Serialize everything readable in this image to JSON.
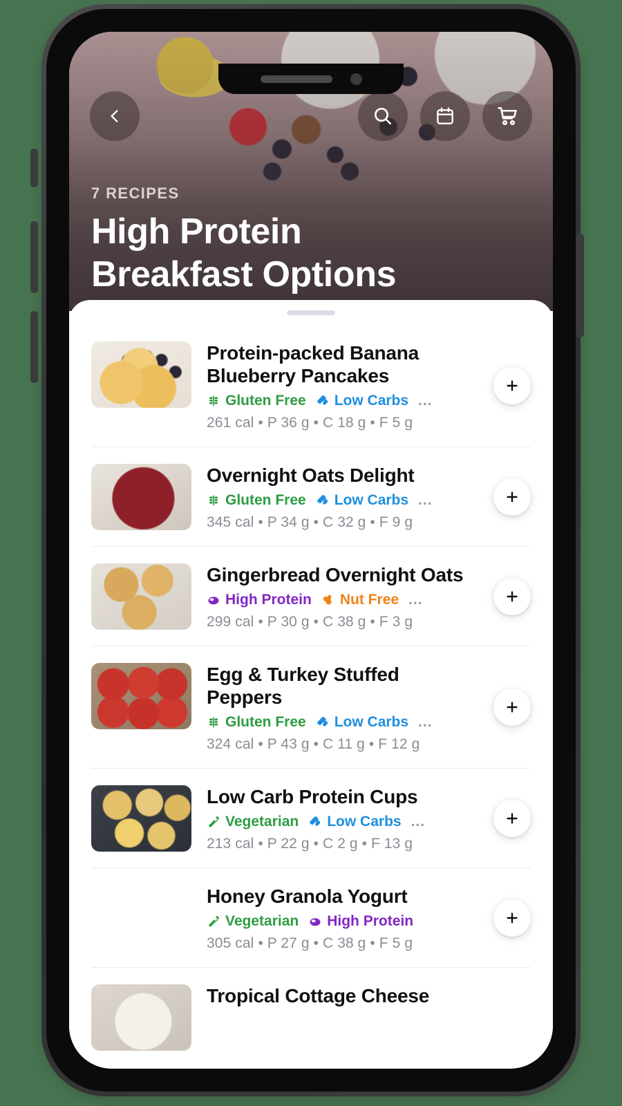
{
  "theme": {
    "page_background": "#477450",
    "sheet_background": "#ffffff",
    "title_color": "#ffffff",
    "tag_colors": {
      "gluten_free": "#2e9c41",
      "low_carbs": "#1e8fe0",
      "high_protein": "#8126c4",
      "nut_free": "#f08317",
      "vegetarian": "#2e9c41"
    },
    "macro_text_color": "#8b8b95",
    "recipe_title_color": "#111111"
  },
  "hero": {
    "back_icon": "chevron-left-icon",
    "actions": [
      {
        "icon": "search-icon",
        "name": "search-button"
      },
      {
        "icon": "calendar-icon",
        "name": "calendar-button"
      },
      {
        "icon": "shopping-cart-icon",
        "name": "cart-button"
      }
    ],
    "eyebrow": "7 RECIPES",
    "title_line1": "High Protein",
    "title_line2": "Breakfast Options"
  },
  "sheet": {
    "grabber": "drag-handle",
    "add_button_icon": "plus-icon",
    "tag_overflow": "...",
    "recipes": [
      {
        "title_line1": "Protein-packed Banana",
        "title_line2": "Blueberry Pancakes",
        "thumb": "pancakes-with-blueberries",
        "tags": [
          {
            "label": "Gluten Free",
            "icon": "wheat-icon",
            "color": "#2e9c41"
          },
          {
            "label": "Low Carbs",
            "icon": "bread-slice-icon",
            "color": "#1e8fe0"
          }
        ],
        "has_more_tags": true,
        "macros": "261 cal • P 36 g • C 18 g • F 5 g"
      },
      {
        "title_line1": "Overnight Oats Delight",
        "title_line2": "",
        "thumb": "berry-oats-bowl",
        "tags": [
          {
            "label": "Gluten Free",
            "icon": "wheat-icon",
            "color": "#2e9c41"
          },
          {
            "label": "Low Carbs",
            "icon": "bread-slice-icon",
            "color": "#1e8fe0"
          }
        ],
        "has_more_tags": true,
        "macros": "345 cal • P 34 g • C 32 g • F 9 g"
      },
      {
        "title_line1": "Gingerbread Overnight Oats",
        "title_line2": "",
        "thumb": "gingerbread-oat-jars",
        "tags": [
          {
            "label": "High Protein",
            "icon": "meat-icon",
            "color": "#8126c4"
          },
          {
            "label": "Nut Free",
            "icon": "peanut-icon",
            "color": "#f08317"
          }
        ],
        "has_more_tags": true,
        "macros": "299 cal • P 30 g • C 38 g • F 3 g"
      },
      {
        "title_line1": "Egg & Turkey Stuffed Peppers",
        "title_line2": "",
        "thumb": "stuffed-red-peppers",
        "tags": [
          {
            "label": "Gluten Free",
            "icon": "wheat-icon",
            "color": "#2e9c41"
          },
          {
            "label": "Low Carbs",
            "icon": "bread-slice-icon",
            "color": "#1e8fe0"
          }
        ],
        "has_more_tags": true,
        "macros": "324 cal • P 43 g • C 11 g • F 12 g"
      },
      {
        "title_line1": "Low Carb Protein Cups",
        "title_line2": "",
        "thumb": "egg-muffin-tin",
        "tags": [
          {
            "label": "Vegetarian",
            "icon": "carrot-icon",
            "color": "#2e9c41"
          },
          {
            "label": "Low Carbs",
            "icon": "bread-slice-icon",
            "color": "#1e8fe0"
          }
        ],
        "has_more_tags": true,
        "macros": "213 cal • P 22 g • C 2 g • F 13 g"
      },
      {
        "title_line1": "Honey Granola Yogurt",
        "title_line2": "",
        "thumb": "yogurt-parfait-glass",
        "tags": [
          {
            "label": "Vegetarian",
            "icon": "carrot-icon",
            "color": "#2e9c41"
          },
          {
            "label": "High Protein",
            "icon": "meat-icon",
            "color": "#8126c4"
          }
        ],
        "has_more_tags": false,
        "macros": "305 cal • P 27 g • C 38 g • F 5 g"
      },
      {
        "title_line1": "Tropical Cottage Cheese",
        "title_line2": "",
        "thumb": "cottage-cheese-bowl",
        "tags": [],
        "has_more_tags": false,
        "macros": ""
      }
    ]
  }
}
